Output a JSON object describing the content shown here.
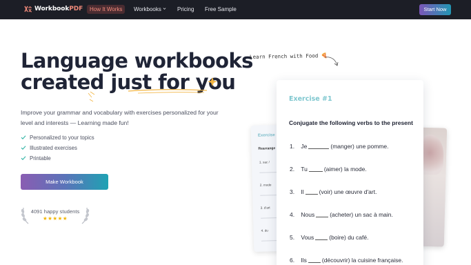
{
  "nav": {
    "logo_text": "Workbook",
    "logo_accent": "PDF",
    "links": [
      {
        "label": "How It Works",
        "active": true
      },
      {
        "label": "Workbooks",
        "dropdown": true
      },
      {
        "label": "Pricing"
      },
      {
        "label": "Free Sample"
      }
    ],
    "cta_label": "Start Now"
  },
  "hero": {
    "title_line1": "Language workbooks",
    "title_line2": "created just for you",
    "description": "Improve your grammar and vocabulary with exercises personalized for your level and interests — Learning made fun!",
    "features": [
      "Personalized to your topics",
      "Illustrated exercises",
      "Printable"
    ],
    "cta_label": "Make Workbook",
    "social_proof": "4091 happy students",
    "stars": "★★★★★"
  },
  "preview": {
    "handnote": "Learn French with Food 🍕",
    "exercise_title": "Exercise #1",
    "instruction": "Conjugate the following verbs to the present",
    "items": [
      {
        "num": "1.",
        "before": "Je",
        "after": "(manger) une pomme."
      },
      {
        "num": "2.",
        "before": "Tu",
        "after": "(aimer) la mode."
      },
      {
        "num": "3.",
        "before": "Il",
        "after": "(voir) une œuvre d'art."
      },
      {
        "num": "4.",
        "before": "Nous",
        "after": "(acheter) un sac à main."
      },
      {
        "num": "5.",
        "before": "Vous",
        "after": "(boire) du café."
      },
      {
        "num": "6.",
        "before": "Ils",
        "after": "(découvrir) la cuisine française."
      }
    ],
    "back_left": {
      "title": "Exercise",
      "subtitle": "Rearrange",
      "items": [
        "1. sac /",
        "2. mode",
        "3. d'art",
        "4. du"
      ]
    }
  },
  "colors": {
    "nav_bg": "#1c1e26",
    "accent_coral": "#f08a7a",
    "gradient_start": "#8a5db2",
    "gradient_end": "#1fa2b3",
    "exercise_teal": "#7fc7cf",
    "star": "#f1b400"
  }
}
